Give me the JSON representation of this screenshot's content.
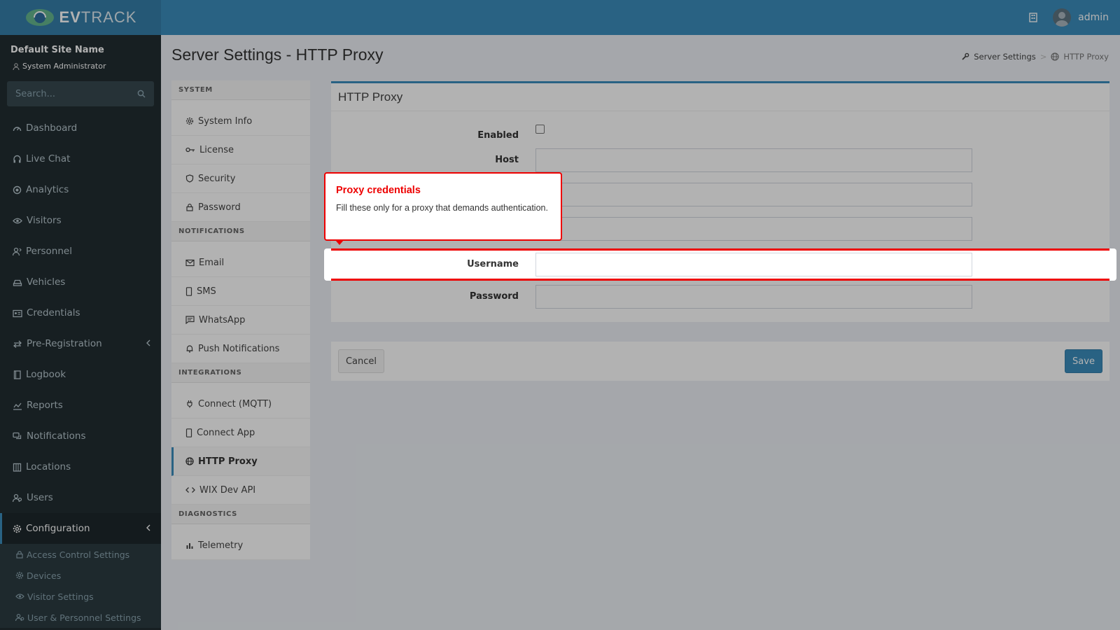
{
  "app": {
    "logo_bold": "EV",
    "logo_rest": "TRACK",
    "user": "admin"
  },
  "sidebar": {
    "site_name": "Default Site Name",
    "role": "System Administrator",
    "search_placeholder": "Search...",
    "items": [
      {
        "label": "Dashboard",
        "icon": "gauge-icon"
      },
      {
        "label": "Live Chat",
        "icon": "headset-icon"
      },
      {
        "label": "Analytics",
        "icon": "target-icon"
      },
      {
        "label": "Visitors",
        "icon": "eye-icon"
      },
      {
        "label": "Personnel",
        "icon": "user-tie-icon"
      },
      {
        "label": "Vehicles",
        "icon": "car-icon"
      },
      {
        "label": "Credentials",
        "icon": "id-card-icon"
      },
      {
        "label": "Pre-Registration",
        "icon": "arrows-icon"
      },
      {
        "label": "Logbook",
        "icon": "book-icon"
      },
      {
        "label": "Reports",
        "icon": "chart-icon"
      },
      {
        "label": "Notifications",
        "icon": "comments-icon"
      },
      {
        "label": "Locations",
        "icon": "building-icon"
      },
      {
        "label": "Users",
        "icon": "users-icon"
      },
      {
        "label": "Configuration",
        "icon": "gear-icon"
      }
    ],
    "subitems": [
      {
        "label": "Access Control Settings",
        "icon": "lock-icon"
      },
      {
        "label": "Devices",
        "icon": "gear-icon"
      },
      {
        "label": "Visitor Settings",
        "icon": "eye-icon"
      },
      {
        "label": "User & Personnel Settings",
        "icon": "users-icon"
      }
    ]
  },
  "page": {
    "title": "Server Settings - HTTP Proxy",
    "breadcrumb": [
      "Server Settings",
      "HTTP Proxy"
    ]
  },
  "settings_nav": {
    "sections": [
      {
        "title": "SYSTEM",
        "items": [
          "System Info",
          "License",
          "Security",
          "Password"
        ]
      },
      {
        "title": "NOTIFICATIONS",
        "items": [
          "Email",
          "SMS",
          "WhatsApp",
          "Push Notifications"
        ]
      },
      {
        "title": "INTEGRATIONS",
        "items": [
          "Connect (MQTT)",
          "Connect App",
          "HTTP Proxy",
          "WIX Dev API"
        ]
      },
      {
        "title": "DIAGNOSTICS",
        "items": [
          "Telemetry"
        ]
      }
    ],
    "active": "HTTP Proxy"
  },
  "form": {
    "panel_title": "HTTP Proxy",
    "fields": [
      {
        "label": "Enabled",
        "type": "checkbox",
        "checked": false
      },
      {
        "label": "Host",
        "type": "text",
        "value": ""
      },
      {
        "label": "",
        "type": "text",
        "value": ""
      },
      {
        "label": "",
        "type": "text",
        "value": ""
      },
      {
        "label": "Username",
        "type": "text",
        "value": ""
      },
      {
        "label": "Password",
        "type": "text",
        "value": ""
      }
    ],
    "cancel_label": "Cancel",
    "save_label": "Save"
  },
  "tooltip": {
    "title": "Proxy credentials",
    "body": "Fill these only for a proxy that demands authentication."
  },
  "colors": {
    "header": "#3c8dbc",
    "sidebar": "#222d32",
    "highlight": "#ee0000"
  }
}
